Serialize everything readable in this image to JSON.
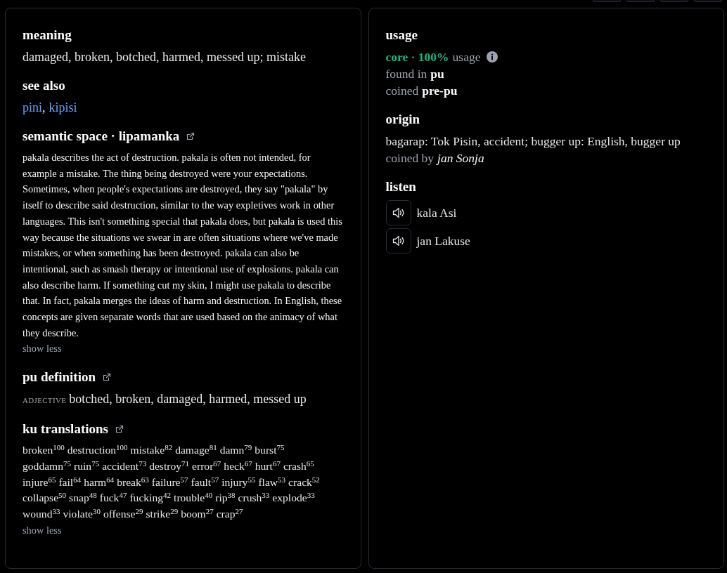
{
  "left_panel": {
    "sections": [
      {
        "kind": "text",
        "heading": "meaning",
        "external_link": false,
        "text": "damaged, broken, botched, harmed, messed up; mistake"
      },
      {
        "kind": "links",
        "heading": "see also",
        "external_link": false,
        "links": [
          "pini",
          "kipisi"
        ],
        "separator": ","
      },
      {
        "kind": "article",
        "heading": "semantic space · lipamanka",
        "external_link": true,
        "text": "pakala describes the act of destruction. pakala is often not intended, for example a mistake. The thing being destroyed were your expectations. Sometimes, when people's expectations are destroyed, they say \"pakala\" by itself to describe said destruction, similar to the way expletives work in other languages. This isn't something special that pakala does, but pakala is used this way because the situations we swear in are often situations where we've made mistakes, or when something has been destroyed. pakala can also be intentional, such as smash therapy or intentional use of explosions. pakala can also describe harm. If something cut my skin, I might use pakala to describe that. In fact, pakala merges the ideas of harm and destruction. In English, these concepts are given separate words that are used based on the animacy of what they describe.",
        "toggle": "show less"
      },
      {
        "kind": "definition",
        "heading": "pu definition",
        "external_link": true,
        "part_of_speech": "ADJECTIVE",
        "text": "botched, broken, damaged, harmed, messed up"
      },
      {
        "kind": "translations",
        "heading": "ku translations",
        "external_link": true,
        "items": [
          {
            "word": "broken",
            "score": "100"
          },
          {
            "word": "destruction",
            "score": "100"
          },
          {
            "word": "mistake",
            "score": "82"
          },
          {
            "word": "damage",
            "score": "81"
          },
          {
            "word": "damn",
            "score": "79"
          },
          {
            "word": "burst",
            "score": "75"
          },
          {
            "word": "goddamn",
            "score": "75"
          },
          {
            "word": "ruin",
            "score": "75"
          },
          {
            "word": "accident",
            "score": "73"
          },
          {
            "word": "destroy",
            "score": "71"
          },
          {
            "word": "error",
            "score": "67"
          },
          {
            "word": "heck",
            "score": "67"
          },
          {
            "word": "hurt",
            "score": "67"
          },
          {
            "word": "crash",
            "score": "65"
          },
          {
            "word": "injure",
            "score": "65"
          },
          {
            "word": "fail",
            "score": "64"
          },
          {
            "word": "harm",
            "score": "64"
          },
          {
            "word": "break",
            "score": "63"
          },
          {
            "word": "failure",
            "score": "57"
          },
          {
            "word": "fault",
            "score": "57"
          },
          {
            "word": "injury",
            "score": "55"
          },
          {
            "word": "flaw",
            "score": "53"
          },
          {
            "word": "crack",
            "score": "52"
          },
          {
            "word": "collapse",
            "score": "50"
          },
          {
            "word": "snap",
            "score": "48"
          },
          {
            "word": "fuck",
            "score": "47"
          },
          {
            "word": "fucking",
            "score": "42"
          },
          {
            "word": "trouble",
            "score": "40"
          },
          {
            "word": "rip",
            "score": "38"
          },
          {
            "word": "crush",
            "score": "33"
          },
          {
            "word": "explode",
            "score": "33"
          },
          {
            "word": "wound",
            "score": "33"
          },
          {
            "word": "violate",
            "score": "30"
          },
          {
            "word": "offense",
            "score": "29"
          },
          {
            "word": "strike",
            "score": "29"
          },
          {
            "word": "boom",
            "score": "27"
          },
          {
            "word": "crap",
            "score": "27"
          }
        ],
        "toggle": "show less"
      }
    ]
  },
  "right_panel": {
    "sections": [
      {
        "kind": "usage",
        "heading": "usage",
        "external_link": false,
        "summary": {
          "highlight": "core · 100%",
          "label": "usage",
          "info": true
        },
        "facts": [
          {
            "label": "found in",
            "value": "pu"
          },
          {
            "label": "coined",
            "value": "pre-pu"
          }
        ]
      },
      {
        "kind": "origin",
        "heading": "origin",
        "external_link": false,
        "text": "bagarap: Tok Pisin, accident; bugger up: English, bugger up",
        "credit": {
          "label": "coined by",
          "value": "jan Sonja"
        }
      },
      {
        "kind": "listen",
        "heading": "listen",
        "external_link": false,
        "recordings": [
          {
            "speaker": "kala Asi"
          },
          {
            "speaker": "jan Lakuse"
          }
        ]
      }
    ]
  }
}
